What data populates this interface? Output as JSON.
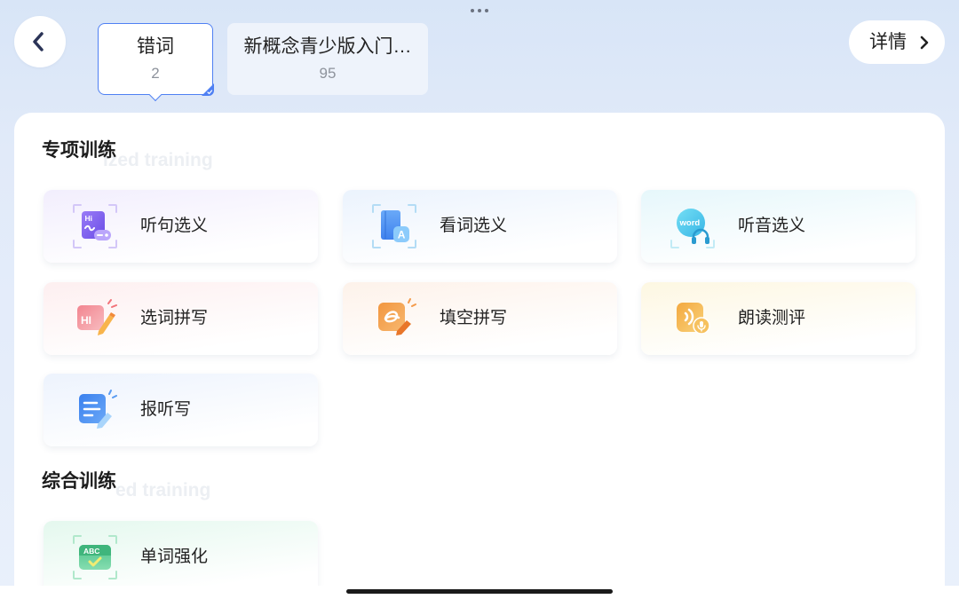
{
  "header": {
    "more_icon": "more-dots-icon",
    "back_icon": "chevron-left-icon",
    "selected_tab": 0,
    "tabs": [
      {
        "title": "错词",
        "count": "2"
      },
      {
        "title": "新概念青少版入门…",
        "count": "95"
      }
    ],
    "details": {
      "label": "详情",
      "icon": "chevron-right-icon"
    }
  },
  "sections": [
    {
      "title": "专项训练",
      "watermark": "ized training",
      "items": [
        {
          "label": "听句选义",
          "icon": "listen-sentence-icon",
          "glyph": "Hi",
          "tint": "#f2eefd"
        },
        {
          "label": "看词选义",
          "icon": "read-word-icon",
          "glyph": "A",
          "tint": "#ebf3fd"
        },
        {
          "label": "听音选义",
          "icon": "listen-sound-icon",
          "glyph": "word",
          "tint": "#e6f7fb"
        },
        {
          "label": "选词拼写",
          "icon": "choose-spell-icon",
          "glyph": "HI",
          "tint": "#fdeff0"
        },
        {
          "label": "填空拼写",
          "icon": "fill-spell-icon",
          "tint": "#fdf2ea"
        },
        {
          "label": "朗读测评",
          "icon": "read-aloud-icon",
          "tint": "#fdf7e2"
        },
        {
          "label": "报听写",
          "icon": "dictation-icon",
          "tint": "#edf3fd"
        }
      ]
    },
    {
      "title": "综合训练",
      "watermark": "ed training",
      "items": [
        {
          "label": "单词强化",
          "icon": "word-reinforce-icon",
          "glyph": "ABC",
          "tint": "#e4f8ee"
        }
      ]
    }
  ],
  "colors": {
    "accent": "#4f80f3",
    "back_chevron": "#2b3457"
  }
}
